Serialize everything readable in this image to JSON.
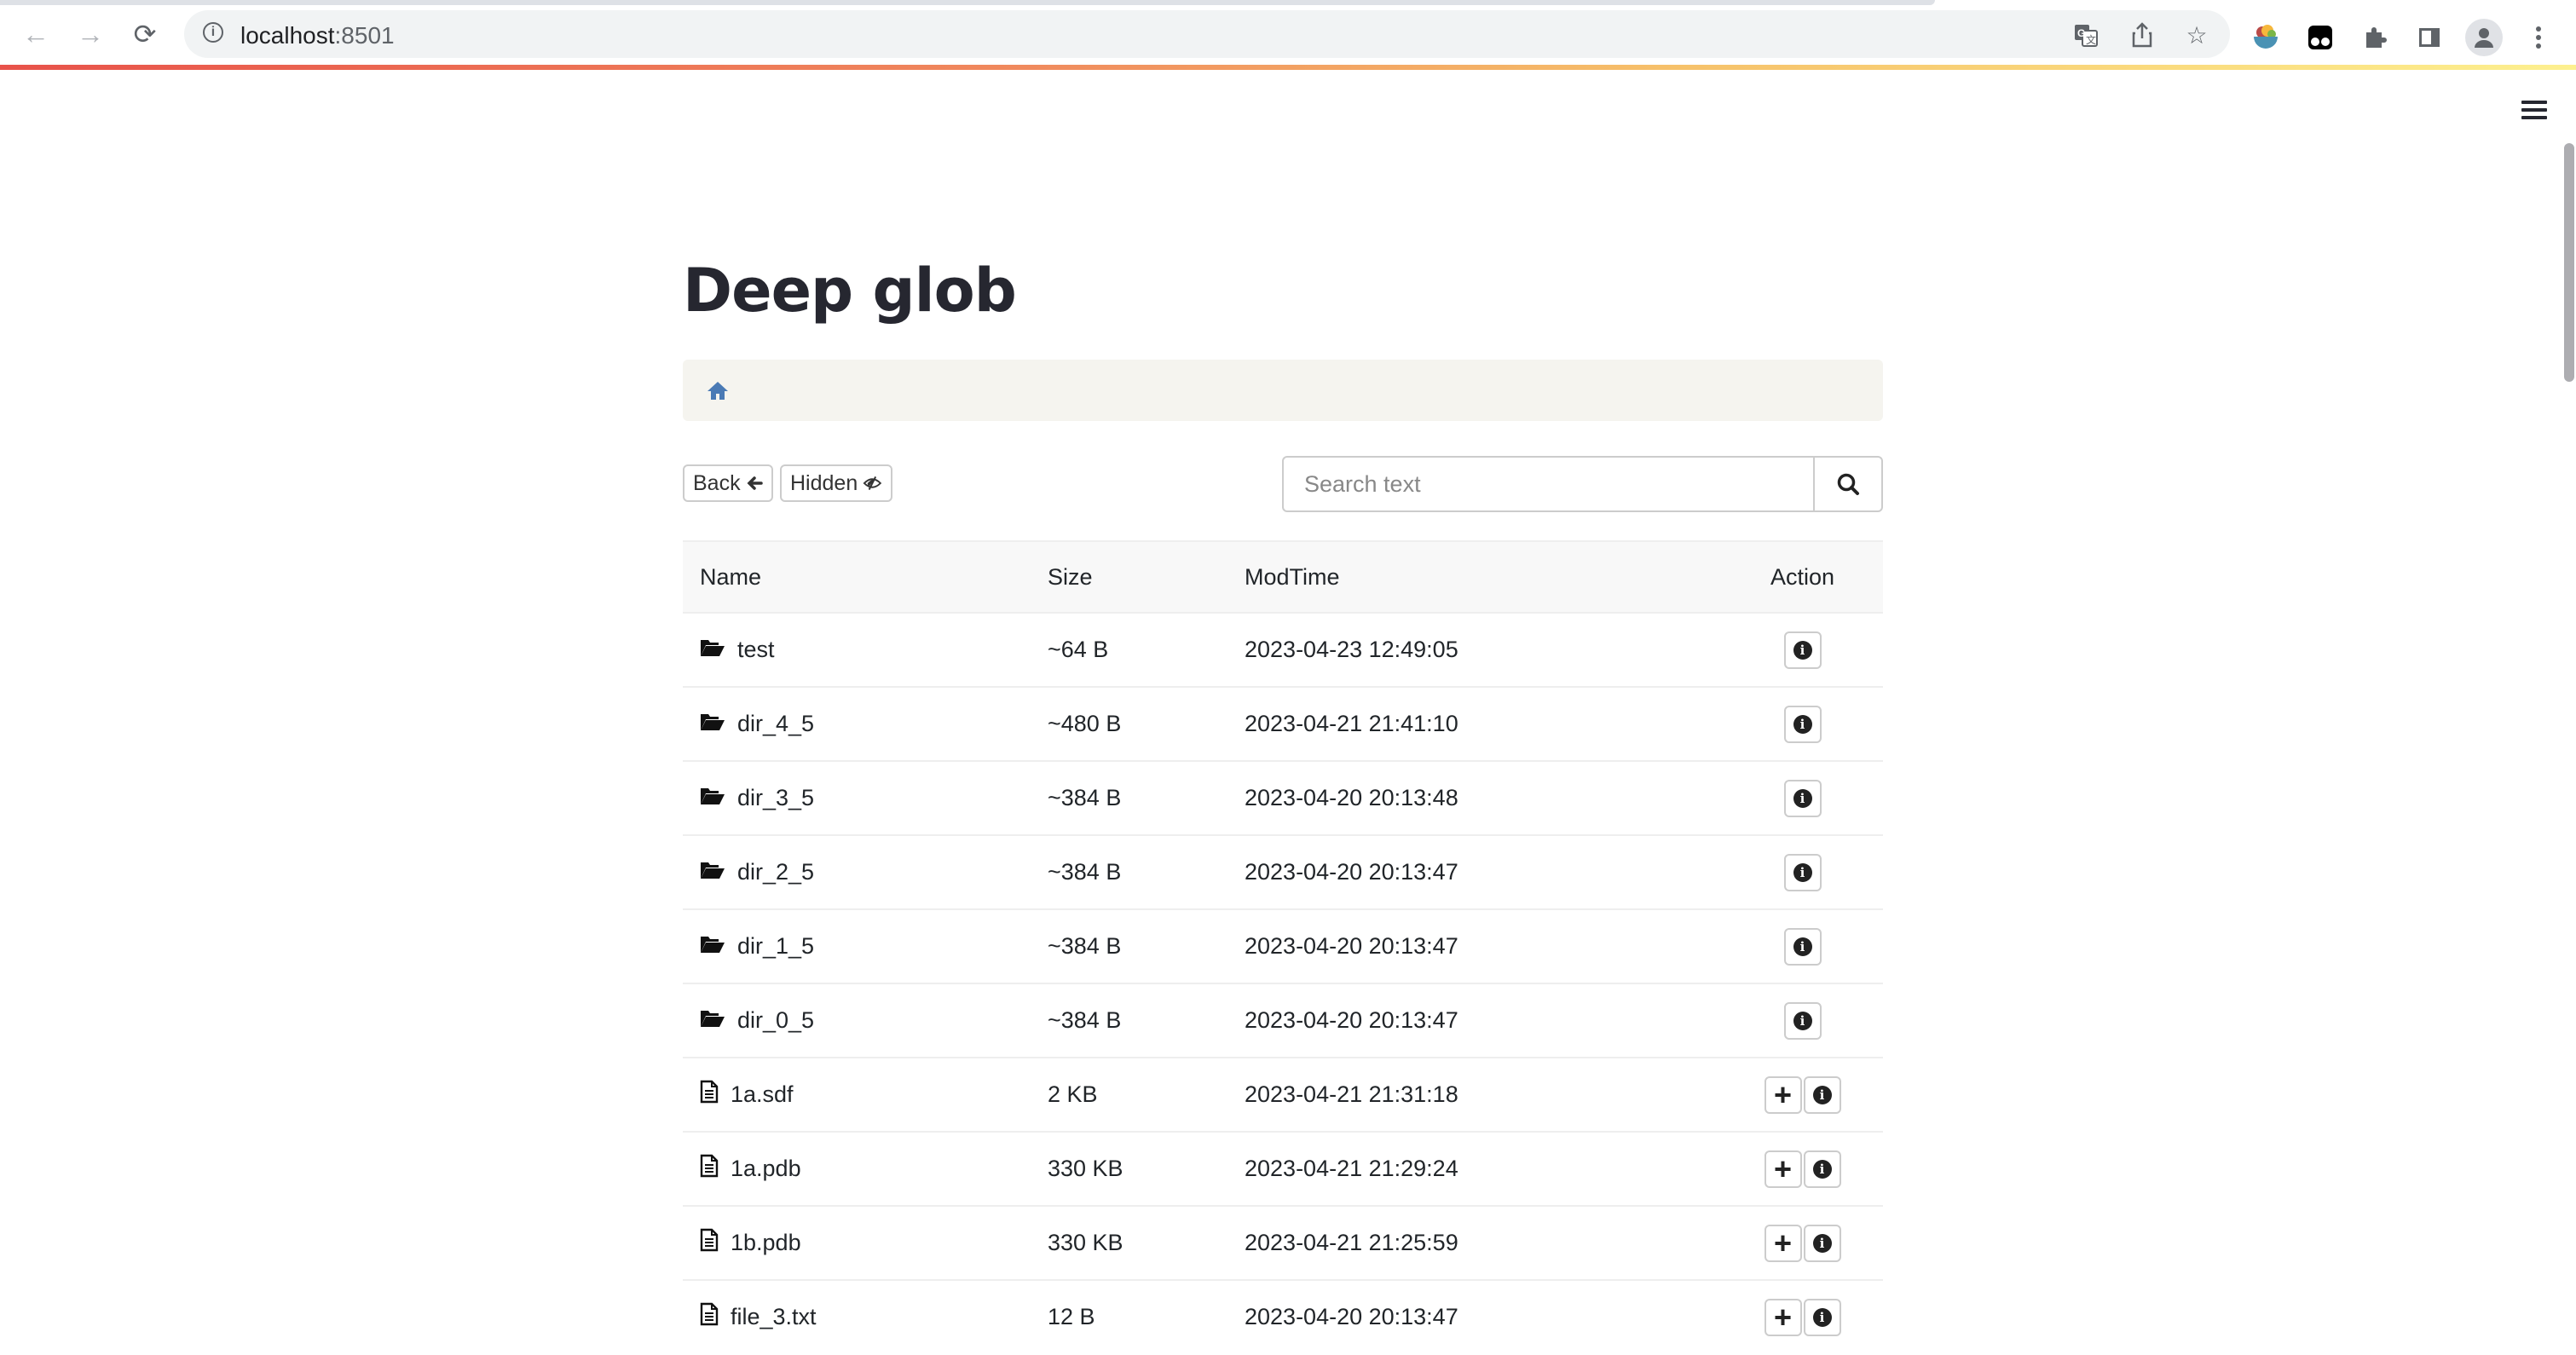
{
  "browser": {
    "url_host": "localhost",
    "url_port": ":8501",
    "toolbar_icons": [
      "back-icon",
      "forward-icon",
      "reload-icon",
      "site-info-icon",
      "translate-icon",
      "share-icon",
      "bookmark-star-icon",
      "extension-bowl-icon",
      "extension-tampermonkey-icon",
      "extensions-puzzle-icon",
      "side-panel-icon",
      "profile-icon",
      "more-menu-icon"
    ]
  },
  "page": {
    "title": "Deep glob",
    "breadcrumb": [
      {
        "icon": "home-icon"
      }
    ],
    "toolbar": {
      "back_label": "Back",
      "hidden_label": "Hidden"
    },
    "search": {
      "placeholder": "Search text",
      "value": ""
    }
  },
  "table": {
    "columns": [
      "Name",
      "Size",
      "ModTime",
      "Action"
    ],
    "rows": [
      {
        "type": "folder",
        "name": "test",
        "size": "~64 B",
        "modtime": "2023-04-23 12:49:05",
        "actions": [
          "info"
        ]
      },
      {
        "type": "folder",
        "name": "dir_4_5",
        "size": "~480 B",
        "modtime": "2023-04-21 21:41:10",
        "actions": [
          "info"
        ]
      },
      {
        "type": "folder",
        "name": "dir_3_5",
        "size": "~384 B",
        "modtime": "2023-04-20 20:13:48",
        "actions": [
          "info"
        ]
      },
      {
        "type": "folder",
        "name": "dir_2_5",
        "size": "~384 B",
        "modtime": "2023-04-20 20:13:47",
        "actions": [
          "info"
        ]
      },
      {
        "type": "folder",
        "name": "dir_1_5",
        "size": "~384 B",
        "modtime": "2023-04-20 20:13:47",
        "actions": [
          "info"
        ]
      },
      {
        "type": "folder",
        "name": "dir_0_5",
        "size": "~384 B",
        "modtime": "2023-04-20 20:13:47",
        "actions": [
          "info"
        ]
      },
      {
        "type": "file",
        "name": "1a.sdf",
        "size": "2 KB",
        "modtime": "2023-04-21 21:31:18",
        "actions": [
          "add",
          "info"
        ]
      },
      {
        "type": "file",
        "name": "1a.pdb",
        "size": "330 KB",
        "modtime": "2023-04-21 21:29:24",
        "actions": [
          "add",
          "info"
        ]
      },
      {
        "type": "file",
        "name": "1b.pdb",
        "size": "330 KB",
        "modtime": "2023-04-21 21:25:59",
        "actions": [
          "add",
          "info"
        ]
      },
      {
        "type": "file",
        "name": "file_3.txt",
        "size": "12 B",
        "modtime": "2023-04-20 20:13:47",
        "actions": [
          "add",
          "info"
        ]
      }
    ]
  },
  "colors": {
    "home_icon": "#4a7ab5",
    "title": "#262730",
    "breadcrumb_bg": "#f5f4ef"
  }
}
